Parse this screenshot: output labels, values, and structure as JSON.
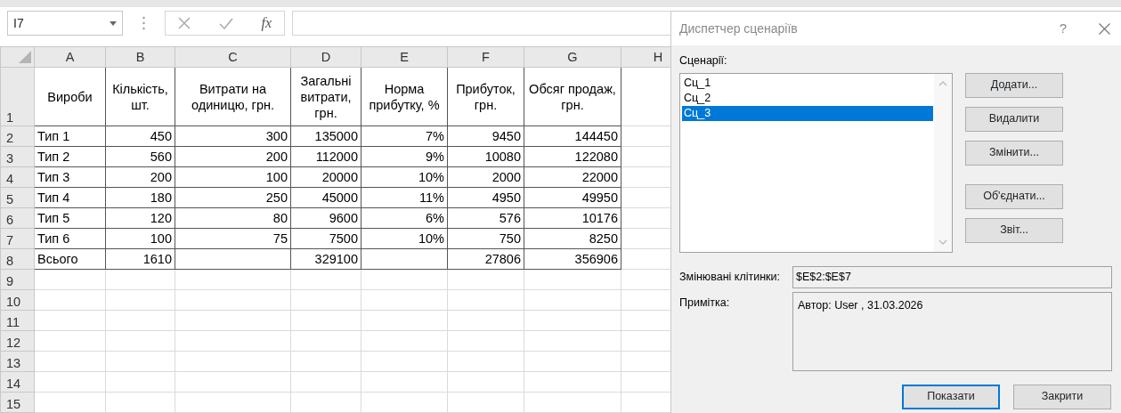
{
  "name_box": {
    "value": "I7"
  },
  "formula_bar": {
    "function_label": "fx"
  },
  "sheet": {
    "columns": [
      "A",
      "B",
      "C",
      "D",
      "E",
      "F",
      "G",
      "H"
    ],
    "rows": [
      {
        "number": "1",
        "cells": [
          "Вироби",
          "Кількість, шт.",
          "Витрати на одиницю, грн.",
          "Загальні витрати, грн.",
          "Норма прибутку, %",
          "Прибуток, грн.",
          "Обсяг продаж, грн."
        ]
      },
      {
        "number": "2",
        "cells": [
          "Тип 1",
          "450",
          "300",
          "135000",
          "7%",
          "9450",
          "144450"
        ]
      },
      {
        "number": "3",
        "cells": [
          "Тип 2",
          "560",
          "200",
          "112000",
          "9%",
          "10080",
          "122080"
        ]
      },
      {
        "number": "4",
        "cells": [
          "Тип 3",
          "200",
          "100",
          "20000",
          "10%",
          "2000",
          "22000"
        ]
      },
      {
        "number": "5",
        "cells": [
          "Тип 4",
          "180",
          "250",
          "45000",
          "11%",
          "4950",
          "49950"
        ]
      },
      {
        "number": "6",
        "cells": [
          "Тип 5",
          "120",
          "80",
          "9600",
          "6%",
          "576",
          "10176"
        ]
      },
      {
        "number": "7",
        "cells": [
          "Тип 6",
          "100",
          "75",
          "7500",
          "10%",
          "750",
          "8250"
        ]
      },
      {
        "number": "8",
        "cells": [
          "Всього",
          "1610",
          null,
          "329100",
          null,
          "27806",
          "356906"
        ]
      },
      {
        "number": "9"
      },
      {
        "number": "10"
      },
      {
        "number": "11"
      },
      {
        "number": "12"
      },
      {
        "number": "13"
      },
      {
        "number": "14"
      },
      {
        "number": "15"
      }
    ]
  },
  "dialog": {
    "title": "Диспетчер сценаріїв",
    "help": "?",
    "scenarios_label": "Сценарії:",
    "scenarios": [
      {
        "name": "Сц_1",
        "selected": false
      },
      {
        "name": "Сц_2",
        "selected": false
      },
      {
        "name": "Сц_3",
        "selected": true
      }
    ],
    "edit_buttons": [
      {
        "label": "Додати..."
      },
      {
        "label": "Видалити"
      },
      {
        "label": "Змінити..."
      }
    ],
    "other_buttons": [
      {
        "label": "Об'єднати..."
      },
      {
        "label": "Звіт..."
      }
    ],
    "changing_cells": {
      "label": "Змінювані клітинки:",
      "value": "$E$2:$E$7"
    },
    "comment": {
      "label": "Примітка:",
      "value": "Автор: User , 31.03.2026"
    },
    "footer_buttons": [
      {
        "label": "Показати",
        "default": true
      },
      {
        "label": "Закрити",
        "default": false
      }
    ]
  }
}
